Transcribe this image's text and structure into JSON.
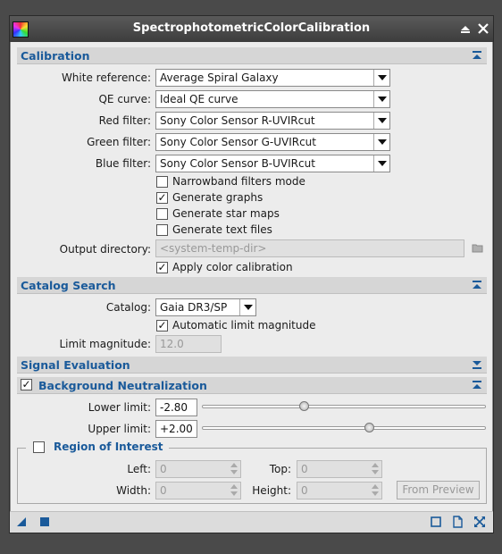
{
  "window": {
    "title": "SpectrophotometricColorCalibration"
  },
  "calibration": {
    "section_title": "Calibration",
    "white_reference": {
      "label": "White reference:",
      "value": "Average Spiral Galaxy"
    },
    "qe_curve": {
      "label": "QE curve:",
      "value": "Ideal QE curve"
    },
    "red_filter": {
      "label": "Red filter:",
      "value": "Sony Color Sensor R-UVIRcut"
    },
    "green_filter": {
      "label": "Green filter:",
      "value": "Sony Color Sensor G-UVIRcut"
    },
    "blue_filter": {
      "label": "Blue filter:",
      "value": "Sony Color Sensor B-UVIRcut"
    },
    "narrowband": {
      "label": "Narrowband filters mode",
      "checked": false
    },
    "generate_graphs": {
      "label": "Generate graphs",
      "checked": true
    },
    "generate_star_maps": {
      "label": "Generate star maps",
      "checked": false
    },
    "generate_text_files": {
      "label": "Generate text files",
      "checked": false
    },
    "output_directory": {
      "label": "Output directory:",
      "placeholder": "<system-temp-dir>"
    },
    "apply_color_calibration": {
      "label": "Apply color calibration",
      "checked": true
    }
  },
  "catalog_search": {
    "section_title": "Catalog Search",
    "catalog": {
      "label": "Catalog:",
      "value": "Gaia DR3/SP"
    },
    "automatic_limit": {
      "label": "Automatic limit magnitude",
      "checked": true
    },
    "limit_magnitude": {
      "label": "Limit magnitude:",
      "value": "12.0"
    }
  },
  "signal_evaluation": {
    "section_title": "Signal Evaluation"
  },
  "background_neutralization": {
    "section_title": "Background Neutralization",
    "checked": true,
    "lower_limit": {
      "label": "Lower limit:",
      "value": "-2.80",
      "slider_fraction": 0.36
    },
    "upper_limit": {
      "label": "Upper limit:",
      "value": "+2.00",
      "slider_fraction": 0.59
    },
    "roi": {
      "title": "Region of Interest",
      "checked": false,
      "left": {
        "label": "Left:",
        "value": "0"
      },
      "top": {
        "label": "Top:",
        "value": "0"
      },
      "width": {
        "label": "Width:",
        "value": "0"
      },
      "height": {
        "label": "Height:",
        "value": "0"
      },
      "from_preview": "From Preview"
    }
  },
  "colors": {
    "accent": "#1a5a9a",
    "titlebar": "#444444",
    "panel": "#ececec"
  }
}
